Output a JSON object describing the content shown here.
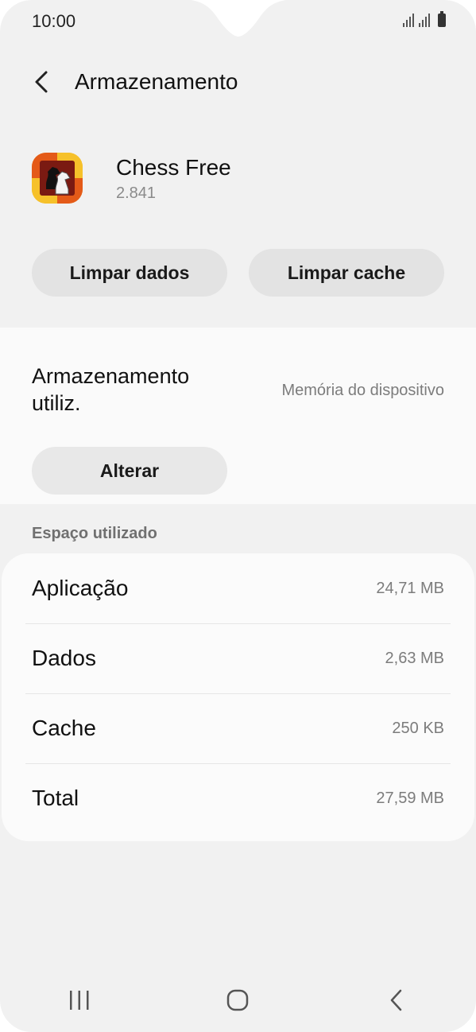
{
  "status_bar": {
    "time": "10:00"
  },
  "header": {
    "title": "Armazenamento"
  },
  "app": {
    "name": "Chess Free",
    "version": "2.841"
  },
  "actions": {
    "clear_data": "Limpar dados",
    "clear_cache": "Limpar cache"
  },
  "storage": {
    "label": "Armazenamento utiliz.",
    "value": "Memória do dispositivo",
    "change_button": "Alterar"
  },
  "usage": {
    "section_title": "Espaço utilizado",
    "rows": [
      {
        "name": "Aplicação",
        "size": "24,71 MB"
      },
      {
        "name": "Dados",
        "size": "2,63 MB"
      },
      {
        "name": "Cache",
        "size": "250 KB"
      },
      {
        "name": "Total",
        "size": "27,59 MB"
      }
    ]
  },
  "colors": {
    "background": "#f1f1f1",
    "card": "#fafafa",
    "button": "#e3e3e3",
    "secondary_text": "#7c7c7c"
  },
  "icons": [
    "back-arrow-icon",
    "cellular-signal-icon",
    "battery-icon",
    "recents-icon",
    "home-icon",
    "back-nav-icon",
    "chess-knight-icon"
  ]
}
